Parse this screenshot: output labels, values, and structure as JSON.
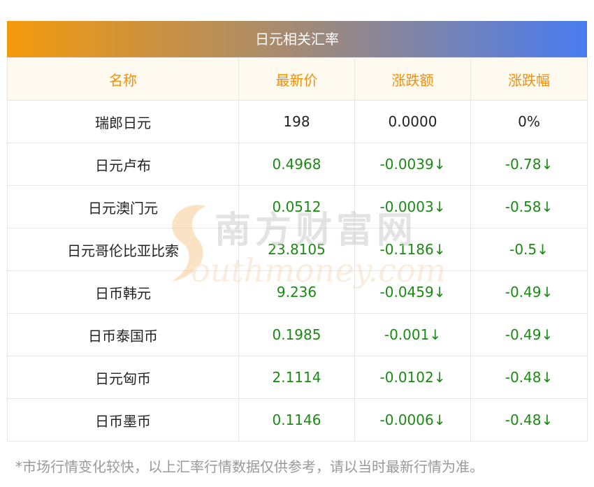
{
  "title": "日元相关汇率",
  "headers": [
    "名称",
    "最新价",
    "涨跌额",
    "涨跌幅"
  ],
  "rows": [
    {
      "name": "瑞郎日元",
      "price": "198",
      "change": "0.0000",
      "pct": "0%",
      "status": "flat"
    },
    {
      "name": "日元卢布",
      "price": "0.4968",
      "change": "-0.0039↓",
      "pct": "-0.78↓",
      "status": "down"
    },
    {
      "name": "日元澳门元",
      "price": "0.0512",
      "change": "-0.0003↓",
      "pct": "-0.58↓",
      "status": "down"
    },
    {
      "name": "日元哥伦比亚比索",
      "price": "23.8105",
      "change": "-0.1186↓",
      "pct": "-0.5↓",
      "status": "down"
    },
    {
      "name": "日币韩元",
      "price": "9.236",
      "change": "-0.0459↓",
      "pct": "-0.49↓",
      "status": "down"
    },
    {
      "name": "日币泰国币",
      "price": "0.1985",
      "change": "-0.001↓",
      "pct": "-0.49↓",
      "status": "down"
    },
    {
      "name": "日元匈币",
      "price": "2.1114",
      "change": "-0.0102↓",
      "pct": "-0.48↓",
      "status": "down"
    },
    {
      "name": "日币墨币",
      "price": "0.1146",
      "change": "-0.0006↓",
      "pct": "-0.48↓",
      "status": "down"
    }
  ],
  "note": "*市场行情变化较快，以上汇率行情数据仅供参考，请以当时最新行情为准。",
  "watermark": {
    "cn": "南方财富网",
    "en": "outhmoney.com"
  },
  "colors": {
    "down": "#1a8a12",
    "header_text": "#f0900a",
    "gradient_start": "#f39a0c",
    "gradient_end": "#4a7cf0"
  }
}
